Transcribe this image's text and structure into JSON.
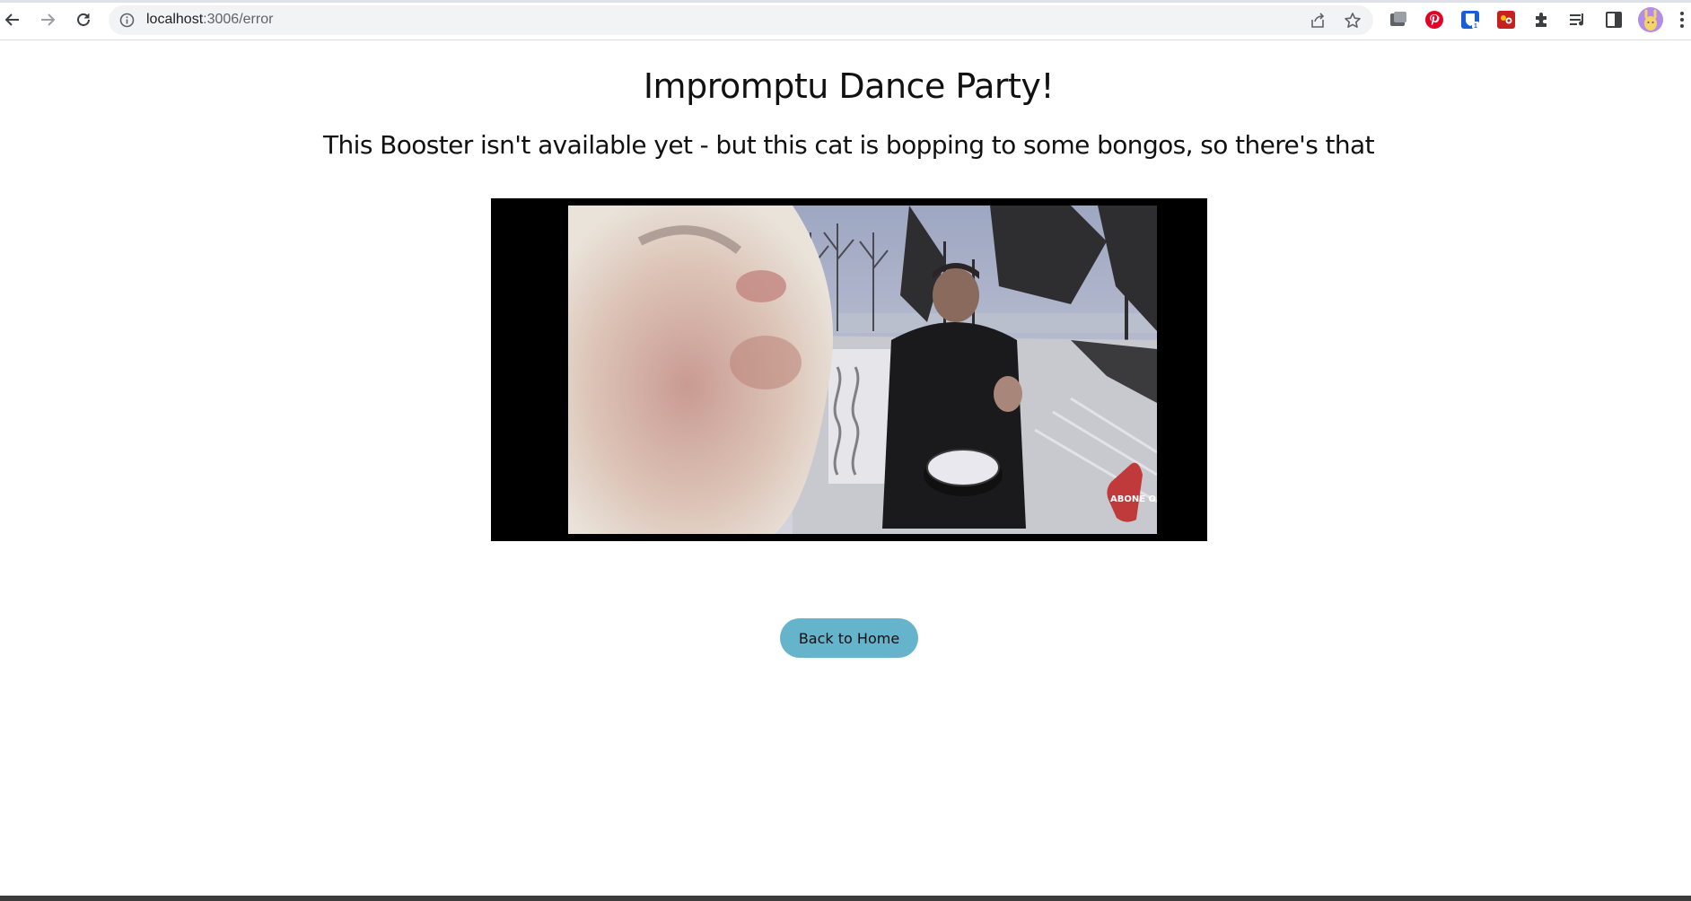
{
  "browser": {
    "url_host": "localhost",
    "url_path": ":3006/error",
    "icons": [
      "back-icon",
      "forward-icon",
      "reload-icon",
      "site-info-icon",
      "share-icon",
      "bookmark-star-icon"
    ],
    "extensions": [
      "window-extension-icon",
      "pinterest-icon",
      "bitwarden-icon",
      "red-extension-icon",
      "puzzle-extensions-icon",
      "media-queue-icon",
      "side-panel-icon",
      "profile-avatar-icon",
      "kebab-menu-icon"
    ],
    "colors": {
      "pinterest": "#e60023",
      "bitwarden": "#175ddc",
      "red_ext": "#c5221f",
      "avatar": "#b28ce6"
    }
  },
  "page": {
    "title": "Impromptu Dance Party!",
    "subtitle": "This Booster isn't available yet - but this cat is bopping to some bongos, so there's that",
    "gif_watermark": "ABONE OL",
    "home_button": "Back to Home",
    "colors": {
      "button": "#66b3cc",
      "frame": "#000000"
    }
  }
}
